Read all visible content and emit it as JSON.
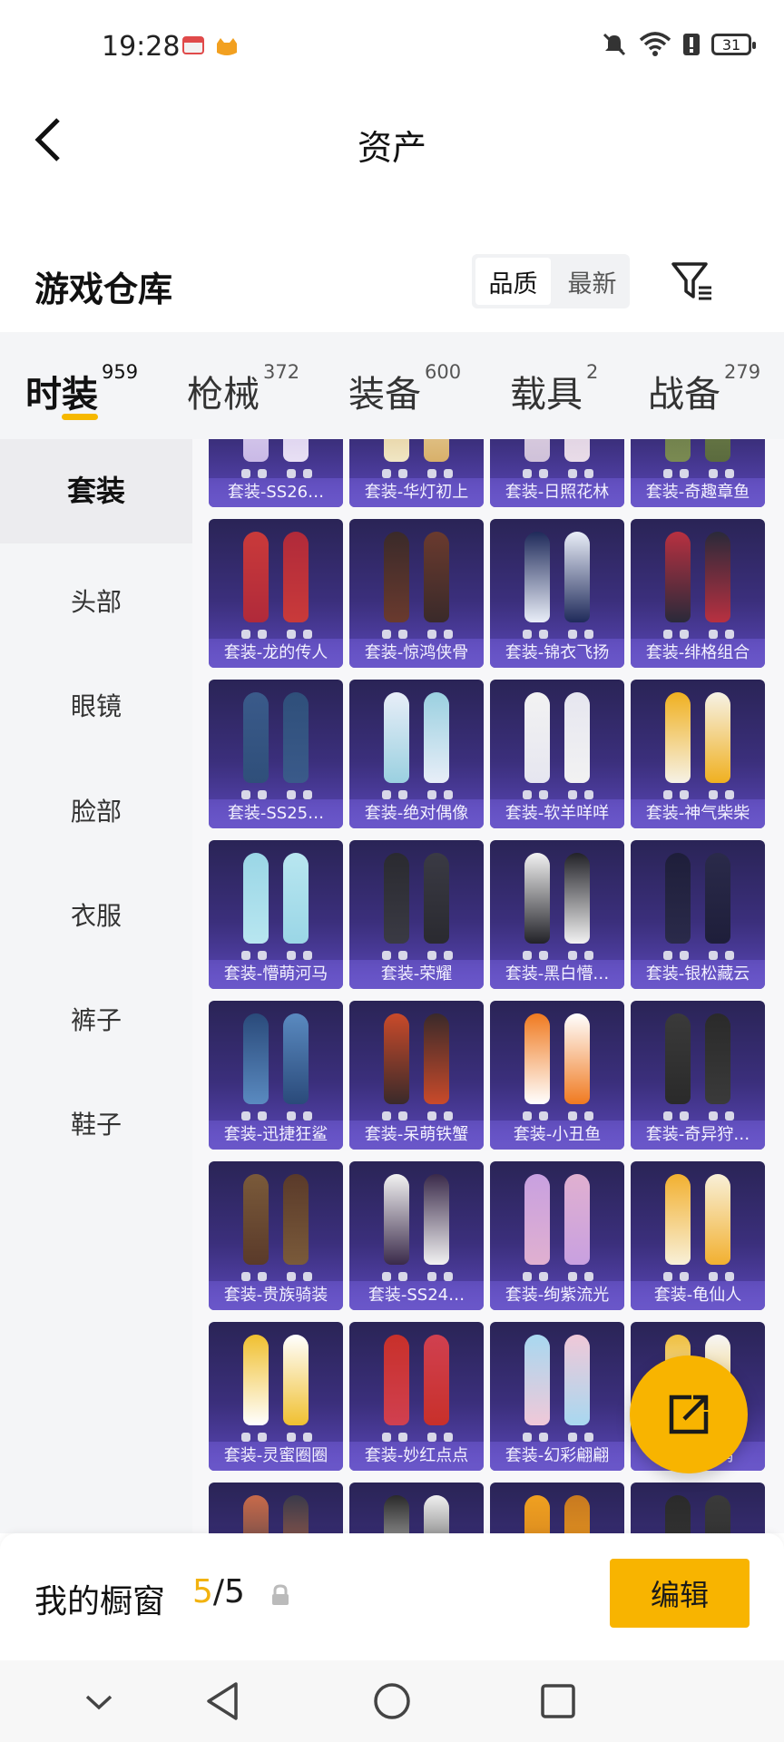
{
  "status": {
    "time": "19:28",
    "battery": "31"
  },
  "header": {
    "title": "资产"
  },
  "section": {
    "title": "游戏仓库",
    "sort_options": [
      "品质",
      "最新"
    ],
    "active_sort": 0
  },
  "tabs": [
    {
      "label": "时装",
      "count": "959"
    },
    {
      "label": "枪械",
      "count": "372"
    },
    {
      "label": "装备",
      "count": "600"
    },
    {
      "label": "载具",
      "count": "2"
    },
    {
      "label": "战备",
      "count": "279"
    }
  ],
  "sidebar": {
    "items": [
      "套装",
      "头部",
      "眼镜",
      "脸部",
      "衣服",
      "裤子",
      "鞋子"
    ]
  },
  "items": [
    "套装-SS26…",
    "套装-华灯初上",
    "套装-日照花林",
    "套装-奇趣章鱼",
    "套装-龙的传人",
    "套装-惊鸿侠骨",
    "套装-锦衣飞扬",
    "套装-绯格组合",
    "套装-SS25…",
    "套装-绝对偶像",
    "套装-软羊咩咩",
    "套装-神气柴柴",
    "套装-懵萌河马",
    "套装-荣耀",
    "套装-黑白懵…",
    "套装-银松藏云",
    "套装-迅捷狂鲨",
    "套装-呆萌铁蟹",
    "套装-小丑鱼",
    "套装-奇异狩…",
    "套装-贵族骑装",
    "套装-SS24…",
    "套装-绚紫流光",
    "套装-龟仙人",
    "套装-灵蜜圈圈",
    "套装-妙红点点",
    "套装-幻彩翩翩",
    "套装-鸥鸣",
    "",
    "",
    "",
    ""
  ],
  "showcase": {
    "label": "我的橱窗",
    "current": "5",
    "total": "/5",
    "edit_label": "编辑"
  },
  "colors": {
    "accent": "#f8b400",
    "card_top": "#2a2456",
    "card_bottom": "#5a47b8"
  },
  "icons": [
    "back-arrow-icon",
    "filter-icon",
    "share-icon",
    "lock-icon",
    "nav-back-icon",
    "nav-home-icon",
    "nav-recents-icon"
  ]
}
